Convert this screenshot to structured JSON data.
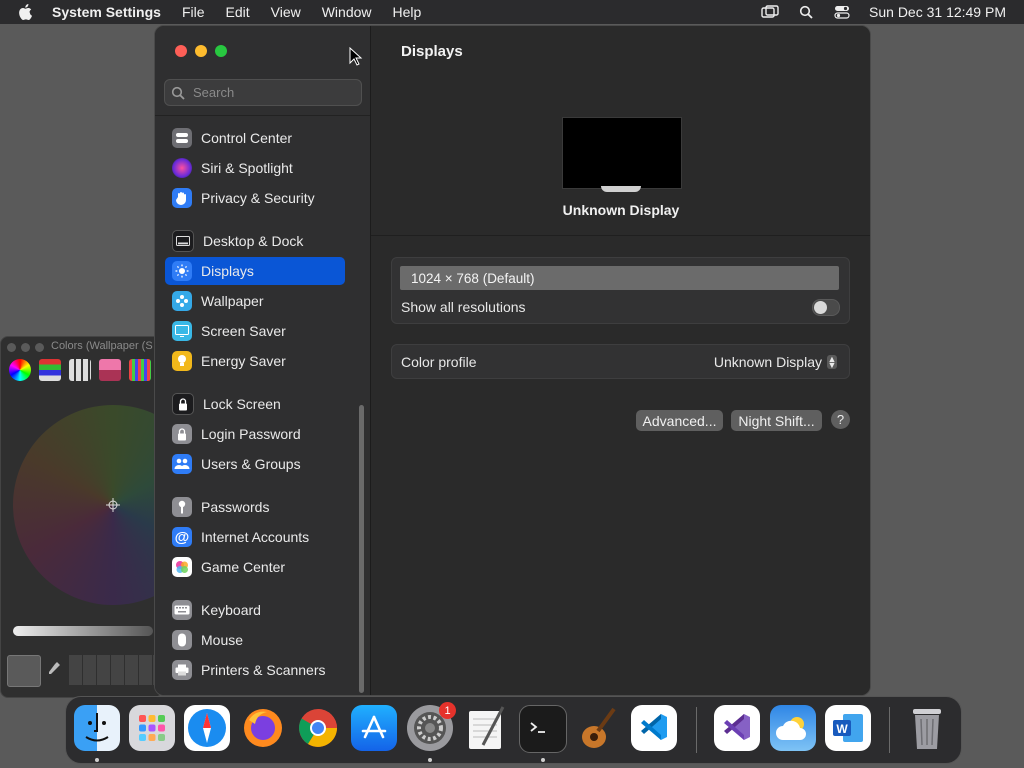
{
  "menubar": {
    "app_name": "System Settings",
    "items": [
      "File",
      "Edit",
      "View",
      "Window",
      "Help"
    ],
    "clock": "Sun Dec 31  12:49 PM"
  },
  "colors_panel": {
    "title": "Colors (Wallpaper (S"
  },
  "window": {
    "search_placeholder": "Search",
    "sidebar": [
      {
        "label": "Control Center",
        "icon": "control-center-icon",
        "color": "#6e6e73"
      },
      {
        "label": "Siri & Spotlight",
        "icon": "siri-icon",
        "color": "#8a2be2"
      },
      {
        "label": "Privacy & Security",
        "icon": "hand-icon",
        "color": "#2f7cf6"
      },
      {
        "label": "Desktop & Dock",
        "icon": "dock-icon",
        "color": "#1c1c1e"
      },
      {
        "label": "Displays",
        "icon": "sun-icon",
        "color": "#2f7cf6"
      },
      {
        "label": "Wallpaper",
        "icon": "wallpaper-icon",
        "color": "#35a9e8"
      },
      {
        "label": "Screen Saver",
        "icon": "screen-saver-icon",
        "color": "#39b8e6"
      },
      {
        "label": "Energy Saver",
        "icon": "bulb-icon",
        "color": "#f2b81b"
      },
      {
        "label": "Lock Screen",
        "icon": "lock-icon",
        "color": "#1c1c1e"
      },
      {
        "label": "Login Password",
        "icon": "login-lock-icon",
        "color": "#8e8e93"
      },
      {
        "label": "Users & Groups",
        "icon": "users-icon",
        "color": "#2f7cf6"
      },
      {
        "label": "Passwords",
        "icon": "key-icon",
        "color": "#8e8e93"
      },
      {
        "label": "Internet Accounts",
        "icon": "at-icon",
        "color": "#2f7cf6"
      },
      {
        "label": "Game Center",
        "icon": "game-center-icon",
        "color": "#ffffff"
      },
      {
        "label": "Keyboard",
        "icon": "keyboard-icon",
        "color": "#8e8e93"
      },
      {
        "label": "Mouse",
        "icon": "mouse-icon",
        "color": "#8e8e93"
      },
      {
        "label": "Printers & Scanners",
        "icon": "printer-icon",
        "color": "#8e8e93"
      }
    ],
    "active_item": "Displays",
    "content": {
      "title": "Displays",
      "display_name": "Unknown Display",
      "resolution": "1024 × 768 (Default)",
      "show_all_label": "Show all resolutions",
      "show_all_on": false,
      "color_profile_label": "Color profile",
      "color_profile_value": "Unknown Display",
      "advanced_label": "Advanced...",
      "night_shift_label": "Night Shift...",
      "help_label": "?"
    }
  },
  "dock": {
    "apps": [
      "Finder",
      "Launchpad",
      "Safari",
      "Firefox",
      "Chrome",
      "App Store",
      "System Settings",
      "TextEdit",
      "Terminal",
      "GarageBand",
      "VS Code",
      "Visual Studio",
      "Weather",
      "Word",
      "Trash"
    ],
    "settings_badge": "1"
  }
}
